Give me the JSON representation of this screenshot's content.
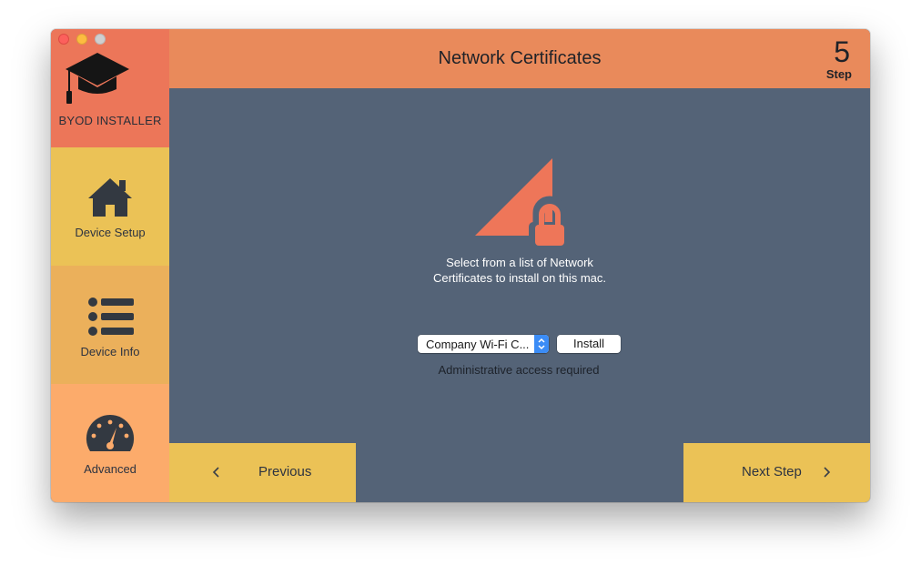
{
  "window": {
    "traffic_lights": [
      "close",
      "minimize",
      "zoom"
    ]
  },
  "sidebar": {
    "brand_label": "BYOD INSTALLER",
    "brand_icon": "graduation-cap-icon",
    "items": [
      {
        "label": "Device Setup",
        "icon": "house-icon",
        "color": "#ebc256"
      },
      {
        "label": "Device Info",
        "icon": "list-icon",
        "color": "#ebb05b"
      },
      {
        "label": "Advanced",
        "icon": "gauge-icon",
        "color": "#fcab6b"
      }
    ]
  },
  "header": {
    "title": "Network Certificates",
    "step_number": "5",
    "step_label": "Step"
  },
  "main": {
    "description_line1": "Select from a list of Network",
    "description_line2": "Certificates to install on this mac.",
    "certificate_select": {
      "selected_value": "Company Wi-Fi C..."
    },
    "install_label": "Install",
    "admin_note": "Administrative access required"
  },
  "footer": {
    "previous_label": "Previous",
    "next_label": "Next Step"
  },
  "colors": {
    "brand": "#ec7659",
    "header": "#e98a5b",
    "content_bg": "#546377",
    "accent_yellow": "#ebc256",
    "cert_icon": "#ee7659"
  }
}
